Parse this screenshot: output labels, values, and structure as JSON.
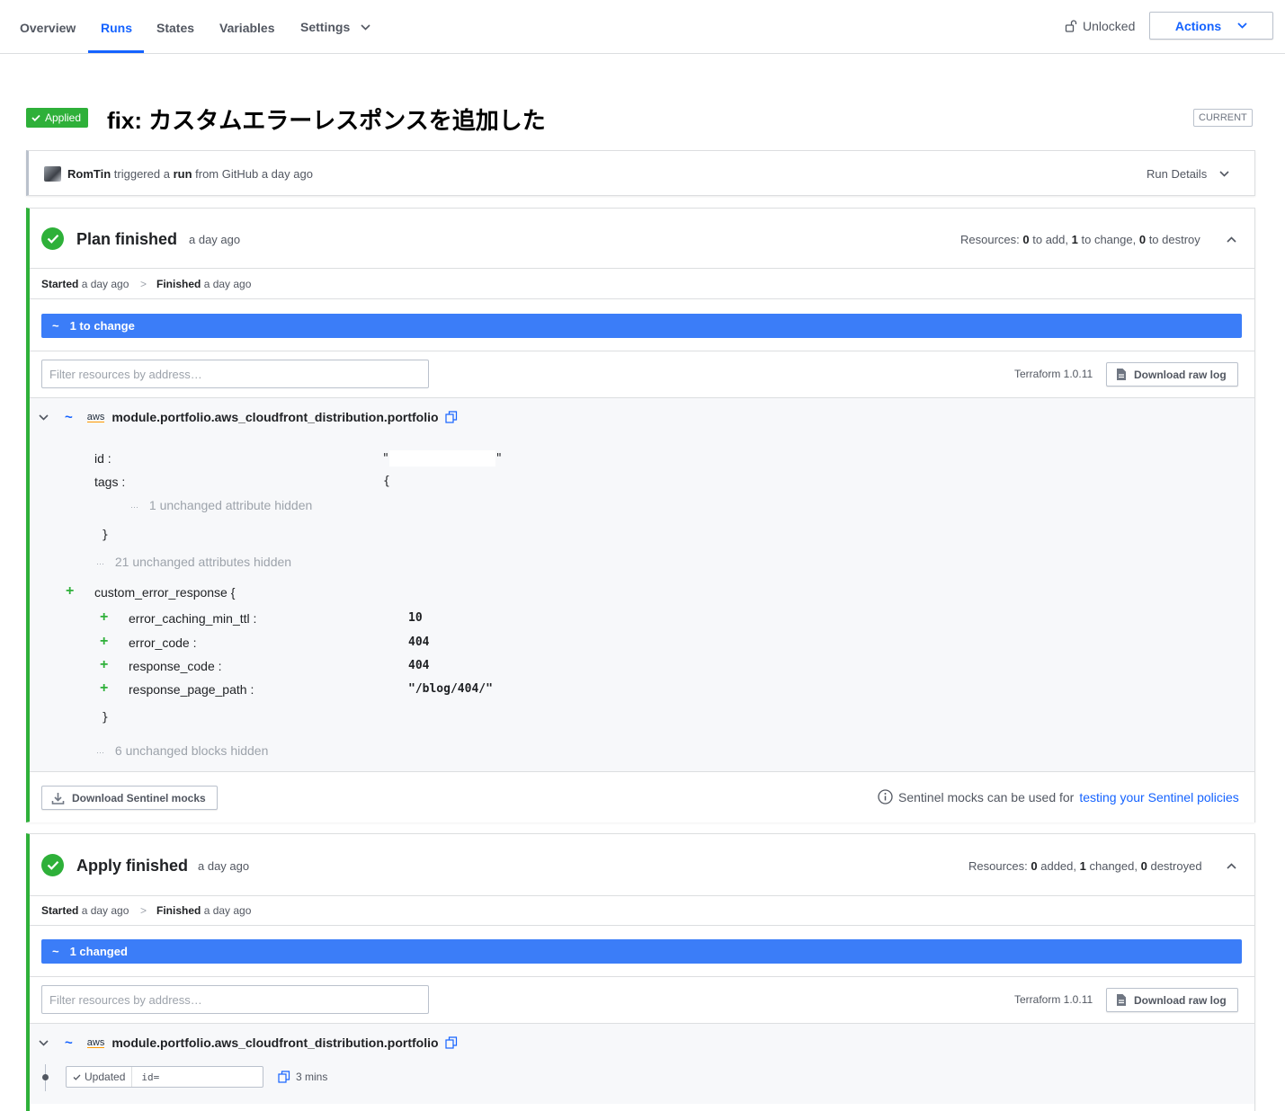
{
  "nav": {
    "tabs": [
      "Overview",
      "Runs",
      "States",
      "Variables",
      "Settings"
    ],
    "lock_label": "Unlocked",
    "actions_label": "Actions"
  },
  "run": {
    "status_badge": "Applied",
    "title": "fix: カスタムエラーレスポンスを追加した",
    "current_badge": "CURRENT",
    "trigger": {
      "user": "RomTin",
      "text1": "triggered a",
      "run_word": "run",
      "text2": "from GitHub a day ago"
    },
    "run_details_label": "Run Details"
  },
  "plan": {
    "title": "Plan finished",
    "time": "a day ago",
    "resources": {
      "prefix": "Resources:",
      "add": "0",
      "add_label": "to add,",
      "change": "1",
      "change_label": "to change,",
      "destroy": "0",
      "destroy_label": "to destroy"
    },
    "started_label": "Started",
    "started_time": "a day ago",
    "sep": ">",
    "finished_label": "Finished",
    "finished_time": "a day ago",
    "summary_symbol": "~",
    "summary": "1 to change",
    "filter_placeholder": "Filter resources by address…",
    "terraform_version": "Terraform 1.0.11",
    "download_log_label": "Download raw log",
    "resource": {
      "provider": "aws",
      "address": "module.portfolio.aws_cloudfront_distribution.portfolio",
      "id_label": "id :",
      "id_quote_open": "\"",
      "id_quote_close": "\"",
      "tags_label": "tags :",
      "tags_open": "{",
      "tags_hidden": "1 unchanged attribute hidden",
      "tags_close": "}",
      "attrs_hidden": "21 unchanged attributes hidden",
      "block_name": "custom_error_response {",
      "block_attrs": [
        {
          "key": "error_caching_min_ttl :",
          "value": "10"
        },
        {
          "key": "error_code :",
          "value": "404"
        },
        {
          "key": "response_code :",
          "value": "404"
        },
        {
          "key": "response_page_path :",
          "value": "\"/blog/404/\""
        }
      ],
      "block_close": "}",
      "blocks_hidden": "6 unchanged blocks hidden",
      "ellipsis": "···",
      "plus": "+"
    },
    "sentinel_button": "Download Sentinel mocks",
    "sentinel_note": "Sentinel mocks can be used for",
    "sentinel_link": "testing your Sentinel policies"
  },
  "apply": {
    "title": "Apply finished",
    "time": "a day ago",
    "resources": {
      "prefix": "Resources:",
      "added": "0",
      "added_label": "added,",
      "changed": "1",
      "changed_label": "changed,",
      "destroyed": "0",
      "destroyed_label": "destroyed"
    },
    "started_label": "Started",
    "started_time": "a day ago",
    "sep": ">",
    "finished_label": "Finished",
    "finished_time": "a day ago",
    "summary_symbol": "~",
    "summary": "1 changed",
    "filter_placeholder": "Filter resources by address…",
    "terraform_version": "Terraform 1.0.11",
    "download_log_label": "Download raw log",
    "resource": {
      "provider": "aws",
      "address": "module.portfolio.aws_cloudfront_distribution.portfolio",
      "updated_label": "Updated",
      "id_text": "id=",
      "duration": "3 mins"
    }
  },
  "colors": {
    "accent": "#1563ff",
    "success": "#2eb039",
    "summary_bar": "#3b7df8"
  }
}
